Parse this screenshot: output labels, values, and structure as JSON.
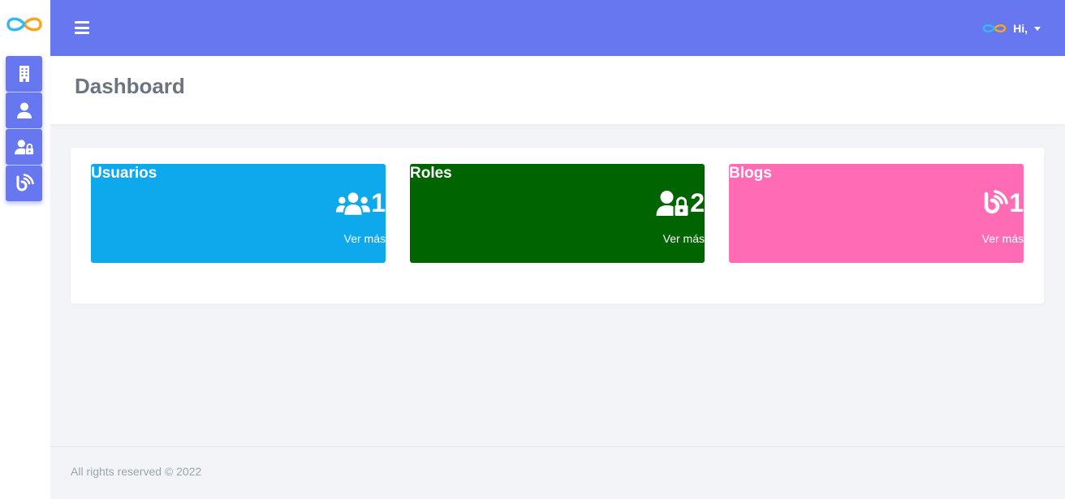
{
  "topbar": {
    "greeting": "Hi,"
  },
  "header": {
    "title": "Dashboard"
  },
  "sidebar": {
    "items": [
      {
        "icon": "building-icon"
      },
      {
        "icon": "user-icon"
      },
      {
        "icon": "user-lock-icon"
      },
      {
        "icon": "blog-icon"
      }
    ]
  },
  "stats": [
    {
      "title": "Usuarios",
      "count": "1",
      "link": "Ver más",
      "icon": "users-icon",
      "color": "#0ea8ec"
    },
    {
      "title": "Roles",
      "count": "2",
      "link": "Ver más",
      "icon": "user-lock-icon",
      "color": "#006400"
    },
    {
      "title": "Blogs",
      "count": "1",
      "link": "Ver más",
      "icon": "blog-icon",
      "color": "#ff6bb5"
    }
  ],
  "footer": {
    "text": "All rights reserved © 2022"
  },
  "colors": {
    "accent": "#6777ef"
  }
}
